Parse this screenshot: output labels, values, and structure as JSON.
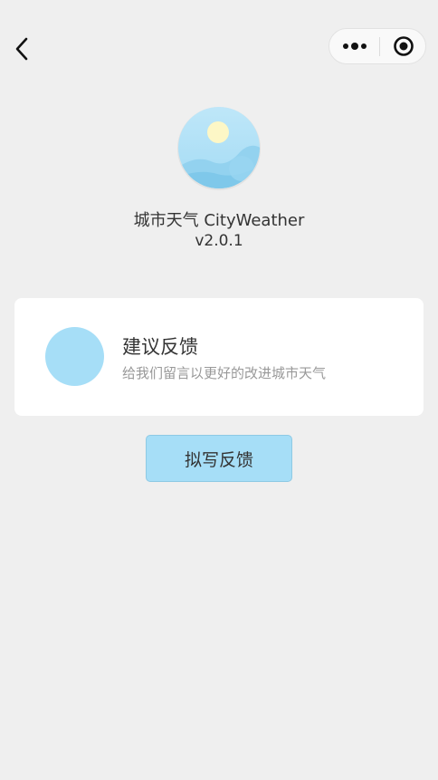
{
  "nav": {
    "back_icon": "chevron-left-icon",
    "more_icon": "more-dots-icon",
    "close_icon": "target-circle-icon"
  },
  "app": {
    "logo_icon": "weather-logo-icon",
    "name": "城市天气 CityWeather",
    "version": "v2.0.1"
  },
  "feedback": {
    "title": "建议反馈",
    "description": "给我们留言以更好的改进城市天气",
    "button_label": "拟写反馈"
  },
  "colors": {
    "background": "#efefef",
    "accent": "#a6def7",
    "card": "#ffffff",
    "text_primary": "#333333",
    "text_secondary": "#999999"
  }
}
